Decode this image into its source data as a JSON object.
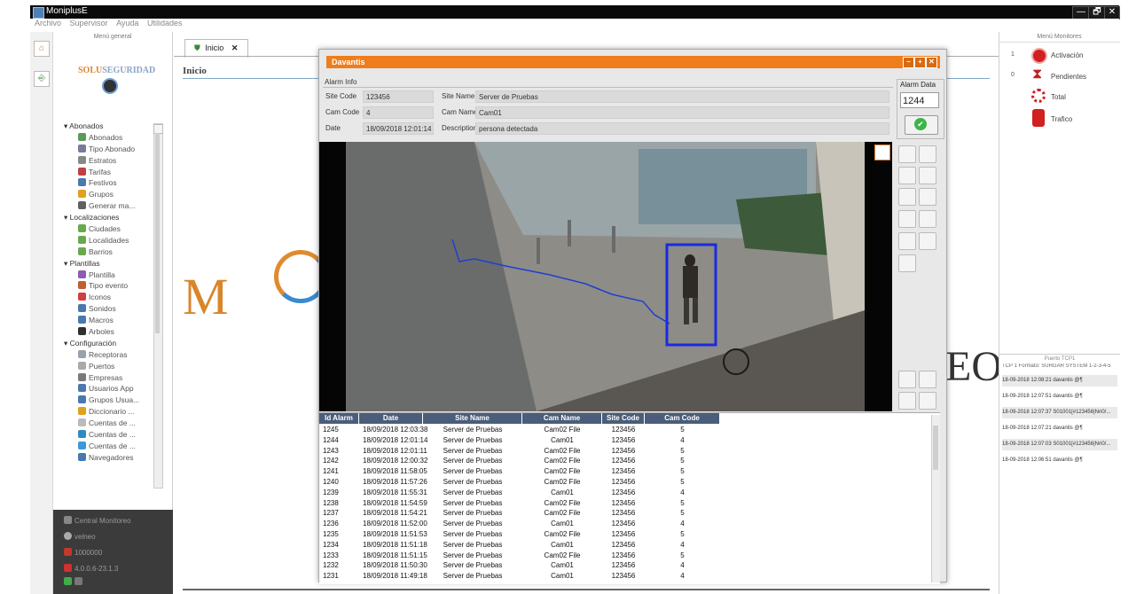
{
  "window": {
    "title": "MoniplusE",
    "minimize": "—",
    "maximize": "🗗",
    "close": "✕"
  },
  "menu": [
    "Archivo",
    "Supervisor",
    "Ayuda",
    "Utilidades"
  ],
  "left_panel": {
    "header": "Menú general",
    "logo_brand": "SOLU",
    "logo_brand2": "SEGURIDAD",
    "tree": [
      {
        "type": "group",
        "label": "Abonados"
      },
      {
        "type": "item",
        "label": "Abonados",
        "color": "#5a9a5a"
      },
      {
        "type": "item",
        "label": "Tipo Abonado",
        "color": "#7a7a9a"
      },
      {
        "type": "item",
        "label": "Estratos",
        "color": "#888888"
      },
      {
        "type": "item",
        "label": "Tarifas",
        "color": "#c04040"
      },
      {
        "type": "item",
        "label": "Festivos",
        "color": "#4a78b0"
      },
      {
        "type": "item",
        "label": "Grupos",
        "color": "#e0a020"
      },
      {
        "type": "item",
        "label": "Generar ma...",
        "color": "#606060"
      },
      {
        "type": "group",
        "label": "Localizaciones"
      },
      {
        "type": "item",
        "label": "Ciudades",
        "color": "#6aa84f"
      },
      {
        "type": "item",
        "label": "Localidades",
        "color": "#6aa84f"
      },
      {
        "type": "item",
        "label": "Barrios",
        "color": "#6aa84f"
      },
      {
        "type": "group",
        "label": "Plantillas"
      },
      {
        "type": "item",
        "label": "Plantilla",
        "color": "#8e5ab8"
      },
      {
        "type": "item",
        "label": "Tipo evento",
        "color": "#c06030"
      },
      {
        "type": "item",
        "label": "Iconos",
        "color": "#d04040"
      },
      {
        "type": "item",
        "label": "Sonidos",
        "color": "#4a78b0"
      },
      {
        "type": "item",
        "label": "Macros",
        "color": "#4a78b0"
      },
      {
        "type": "item",
        "label": "Arboles",
        "color": "#303030"
      },
      {
        "type": "group",
        "label": "Configuración"
      },
      {
        "type": "item",
        "label": "Receptoras",
        "color": "#9aa0b0"
      },
      {
        "type": "item",
        "label": "Puertos",
        "color": "#aaaaaa"
      },
      {
        "type": "item",
        "label": "Empresas",
        "color": "#7a7a7a"
      },
      {
        "type": "item",
        "label": "Usuarios App",
        "color": "#4a78b0"
      },
      {
        "type": "item",
        "label": "Grupos Usua...",
        "color": "#4a78b0"
      },
      {
        "type": "item",
        "label": "Diccionario ...",
        "color": "#e0a020"
      },
      {
        "type": "item",
        "label": "Cuentas de ...",
        "color": "#bbbbbb"
      },
      {
        "type": "item",
        "label": "Cuentas de ...",
        "color": "#2e8bc0"
      },
      {
        "type": "item",
        "label": "Cuentas de ...",
        "color": "#3a9ad9"
      },
      {
        "type": "item",
        "label": "Navegadores",
        "color": "#4a78b0"
      }
    ],
    "footer": [
      "Central Monitoreo",
      "velneo",
      "1000000",
      "4.0.0.6-23.1.3"
    ]
  },
  "main": {
    "tab": "Inicio",
    "tab_close": "✕",
    "title": "Inicio",
    "bg_text_left": "M",
    "bg_text_right": "EO"
  },
  "right_panel": {
    "header": "Menú Monitores",
    "monitors": [
      {
        "count": "1",
        "label": "Activación"
      },
      {
        "count": "0",
        "label": "Pendientes"
      },
      {
        "count": "",
        "label": "Total"
      },
      {
        "count": "",
        "label": "Trafico"
      }
    ],
    "port_header": "Puerto TCP1",
    "port_format": "TCP 1 Formato: SURGAR SYSTEM 1-2-3-4-5",
    "port_log": [
      "18-09-2018 12:08:21  davantis @¶",
      "18-09-2018 12:07:51  davantis @¶",
      "18-09-2018 12:07:37  S01001[#123456|Nri0/...",
      "18-09-2018 12:07:21  davantis @¶",
      "18-09-2018 12:07:03  S01001[#123456|Nri0/...",
      "18-09-2018 12:06:51  davantis @¶"
    ]
  },
  "dialog": {
    "title": "Davantis",
    "alarm_info_label": "Alarm Info",
    "site_code_label": "Site Code",
    "site_code": "123456",
    "site_name_label": "Site Name",
    "site_name": "Server de Pruebas",
    "cam_code_label": "Cam Code",
    "cam_code": "4",
    "cam_name_label": "Cam Name",
    "cam_name": "Cam01",
    "date_label": "Date",
    "date": "18/09/2018 12:01:14",
    "description_label": "Description",
    "description": "persona detectada",
    "alarm_data_label": "Alarm Data",
    "alarm_data": "1244",
    "ok_icon": "✔",
    "columns": [
      "Id Alarm",
      "Date",
      "Site Name",
      "Cam Name",
      "Site Code",
      "Cam Code"
    ],
    "rows": [
      [
        "1245",
        "18/09/2018 12:03:38",
        "Server de Pruebas",
        "Cam02 File",
        "123456",
        "5"
      ],
      [
        "1244",
        "18/09/2018 12:01:14",
        "Server de Pruebas",
        "Cam01",
        "123456",
        "4"
      ],
      [
        "1243",
        "18/09/2018 12:01:11",
        "Server de Pruebas",
        "Cam02 File",
        "123456",
        "5"
      ],
      [
        "1242",
        "18/09/2018 12:00:32",
        "Server de Pruebas",
        "Cam02 File",
        "123456",
        "5"
      ],
      [
        "1241",
        "18/09/2018 11:58:05",
        "Server de Pruebas",
        "Cam02 File",
        "123456",
        "5"
      ],
      [
        "1240",
        "18/09/2018 11:57:26",
        "Server de Pruebas",
        "Cam02 File",
        "123456",
        "5"
      ],
      [
        "1239",
        "18/09/2018 11:55:31",
        "Server de Pruebas",
        "Cam01",
        "123456",
        "4"
      ],
      [
        "1238",
        "18/09/2018 11:54:59",
        "Server de Pruebas",
        "Cam02 File",
        "123456",
        "5"
      ],
      [
        "1237",
        "18/09/2018 11:54:21",
        "Server de Pruebas",
        "Cam02 File",
        "123456",
        "5"
      ],
      [
        "1236",
        "18/09/2018 11:52:00",
        "Server de Pruebas",
        "Cam01",
        "123456",
        "4"
      ],
      [
        "1235",
        "18/09/2018 11:51:53",
        "Server de Pruebas",
        "Cam02 File",
        "123456",
        "5"
      ],
      [
        "1234",
        "18/09/2018 11:51:18",
        "Server de Pruebas",
        "Cam01",
        "123456",
        "4"
      ],
      [
        "1233",
        "18/09/2018 11:51:15",
        "Server de Pruebas",
        "Cam02 File",
        "123456",
        "5"
      ],
      [
        "1232",
        "18/09/2018 11:50:30",
        "Server de Pruebas",
        "Cam01",
        "123456",
        "4"
      ],
      [
        "1231",
        "18/09/2018 11:49:18",
        "Server de Pruebas",
        "Cam01",
        "123456",
        "4"
      ]
    ]
  }
}
